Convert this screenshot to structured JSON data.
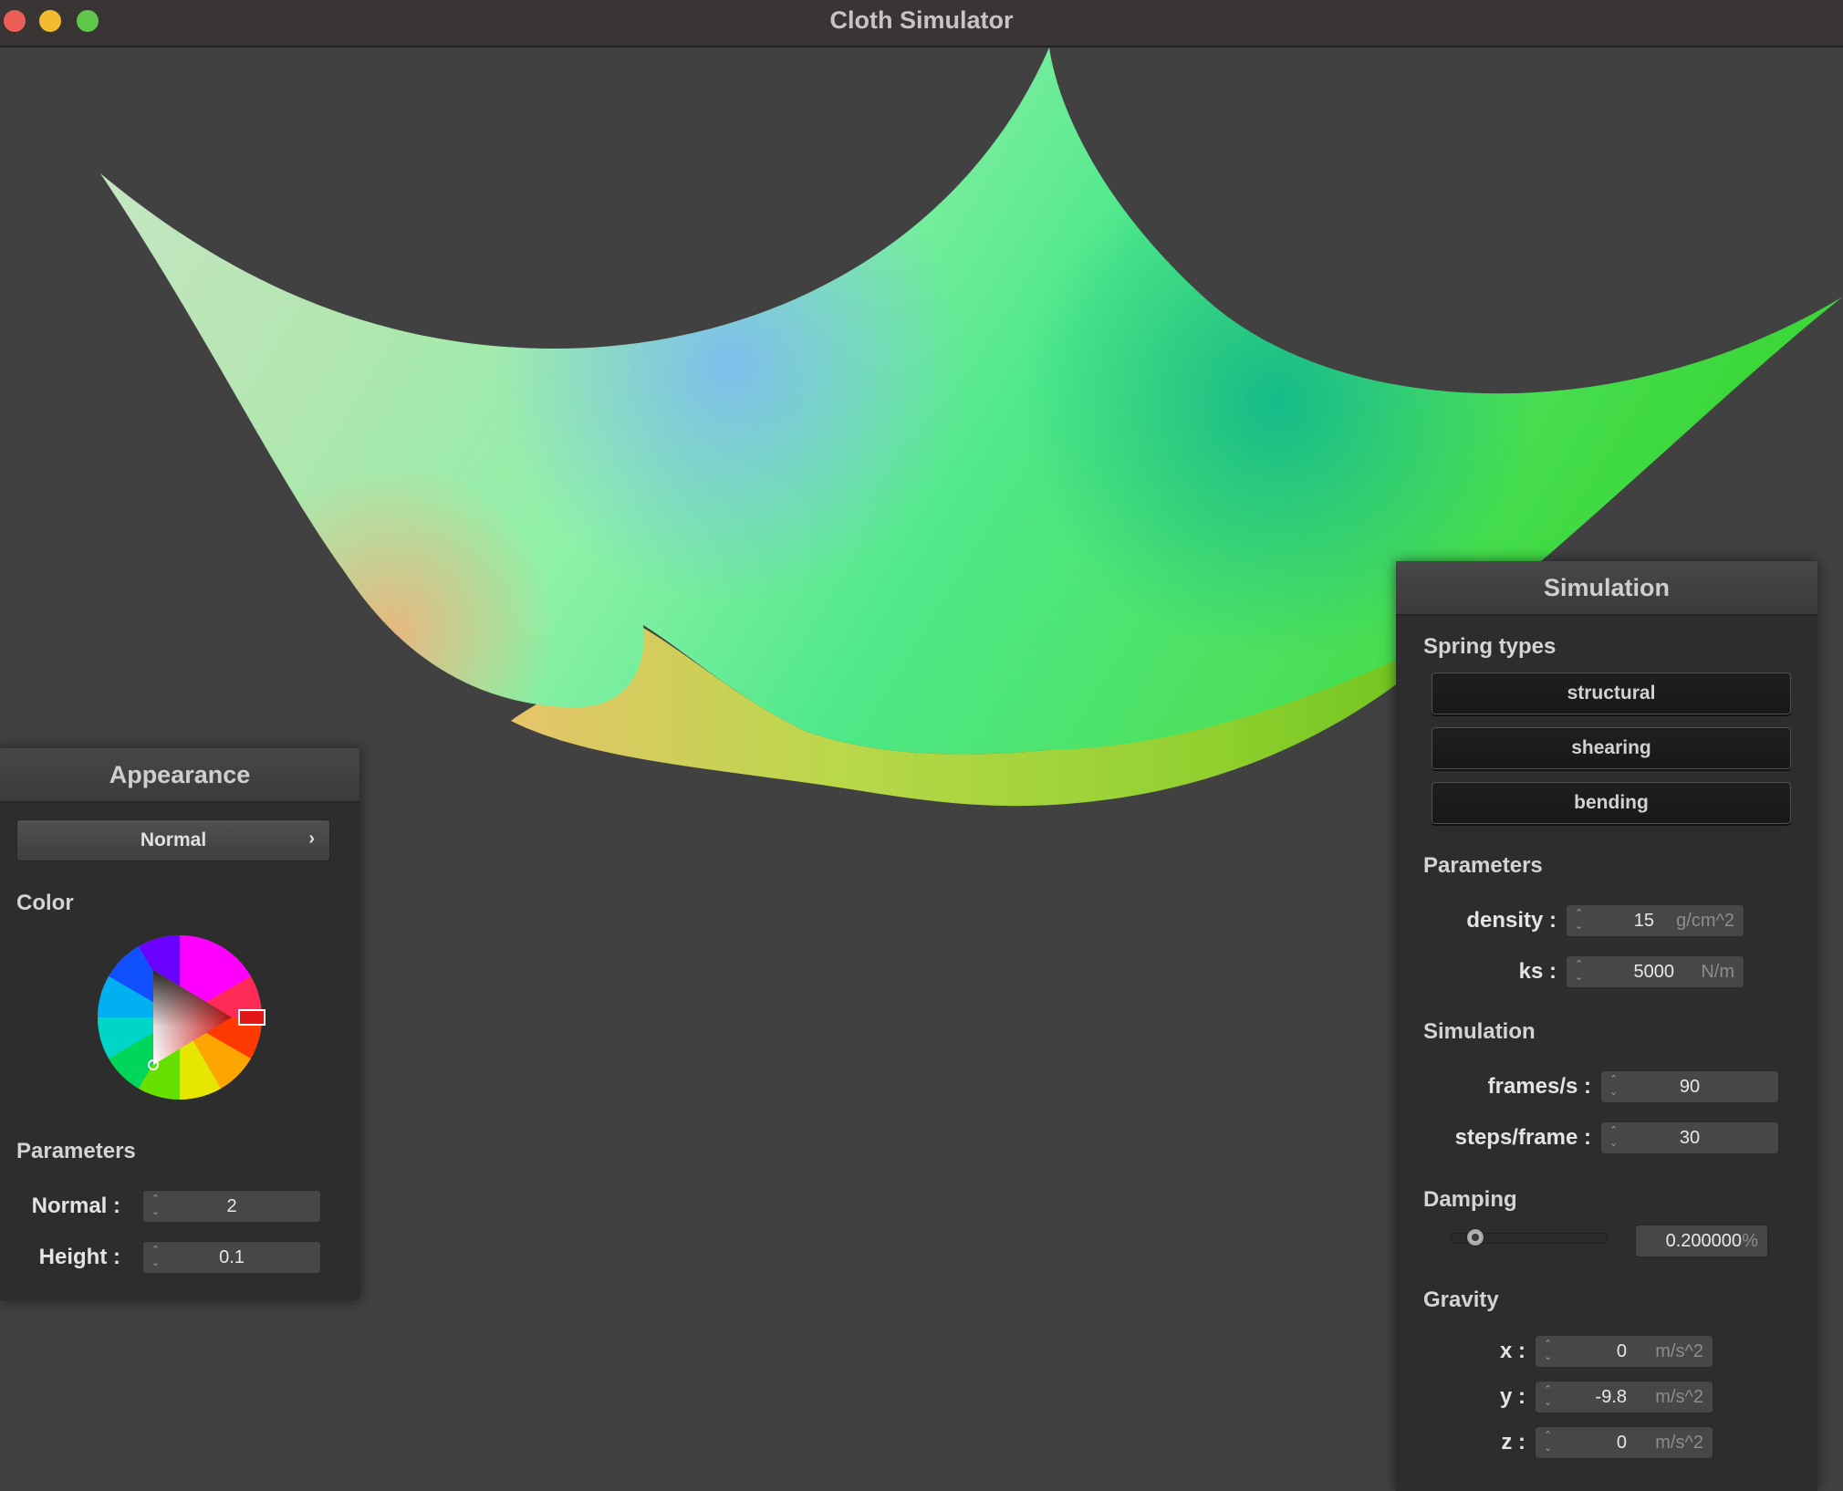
{
  "window": {
    "title": "Cloth Simulator"
  },
  "appearance": {
    "title": "Appearance",
    "shader_select": "Normal",
    "color_label": "Color",
    "parameters_label": "Parameters",
    "normal_label": "Normal :",
    "normal_value": "2",
    "height_label": "Height :",
    "height_value": "0.1"
  },
  "simulation": {
    "title": "Simulation",
    "spring_types_label": "Spring types",
    "spring_buttons": [
      "structural",
      "shearing",
      "bending"
    ],
    "parameters_label": "Parameters",
    "density_label": "density :",
    "density_value": "15",
    "density_unit": "g/cm^2",
    "ks_label": "ks :",
    "ks_value": "5000",
    "ks_unit": "N/m",
    "simulation_label": "Simulation",
    "fps_label": "frames/s :",
    "fps_value": "90",
    "steps_label": "steps/frame :",
    "steps_value": "30",
    "damping_label": "Damping",
    "damping_value": "0.200000",
    "damping_unit": "%",
    "damping_slider_fraction": 0.15,
    "gravity_label": "Gravity",
    "gx_label": "x :",
    "gx_value": "0",
    "gy_label": "y :",
    "gy_value": "-9.8",
    "gz_label": "z :",
    "gz_value": "0",
    "gravity_unit": "m/s^2"
  }
}
